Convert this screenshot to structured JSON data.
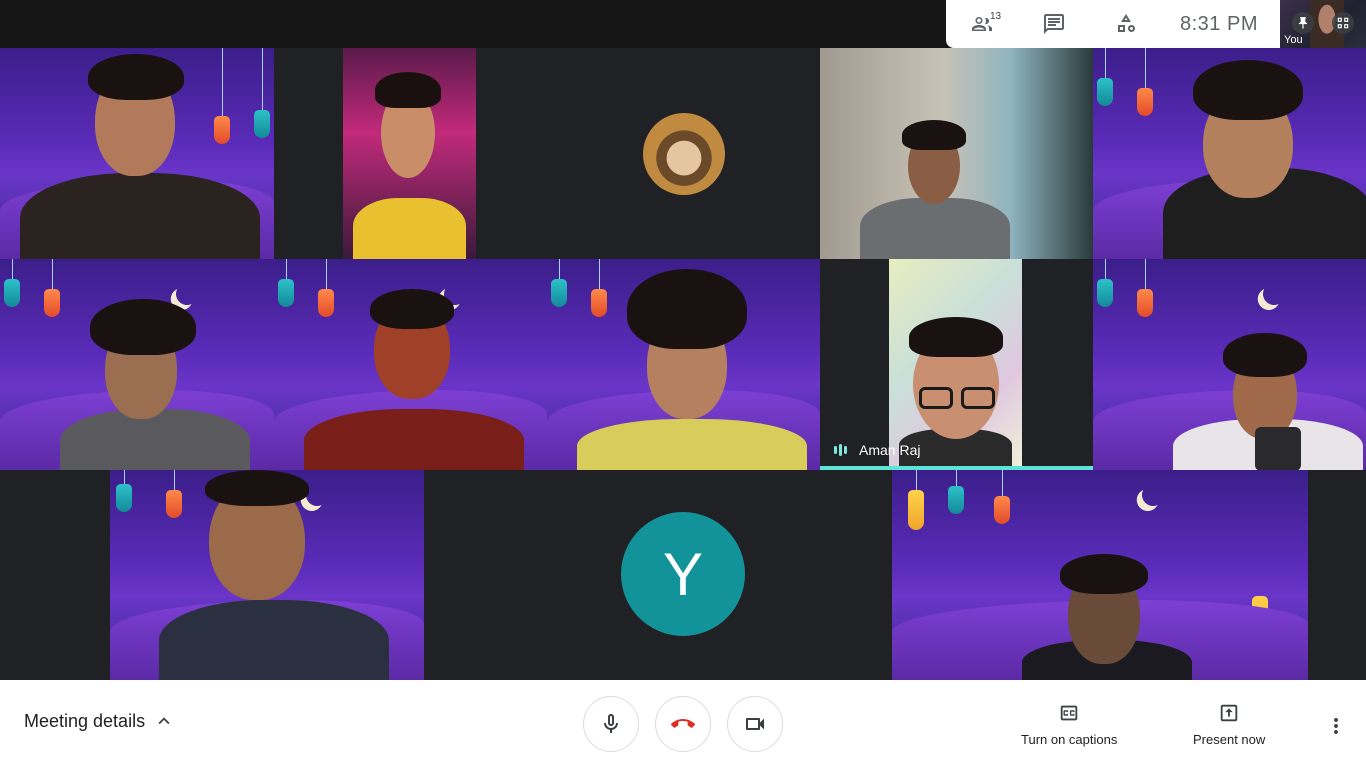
{
  "top_bar": {
    "participants_count": "13",
    "time": "8:31 PM",
    "icons": [
      "participants-icon",
      "chat-icon",
      "activities-icon"
    ]
  },
  "self_view": {
    "label": "You"
  },
  "tiles": {
    "speaker_name": "Aman Raj",
    "avatar_initial": "Y"
  },
  "bottom_bar": {
    "meeting_details": "Meeting details",
    "captions_label": "Turn on captions",
    "present_label": "Present now"
  },
  "colors": {
    "avatar_bg": "#12939a",
    "hangup": "#d93025",
    "speaking": "#5de4d6"
  }
}
